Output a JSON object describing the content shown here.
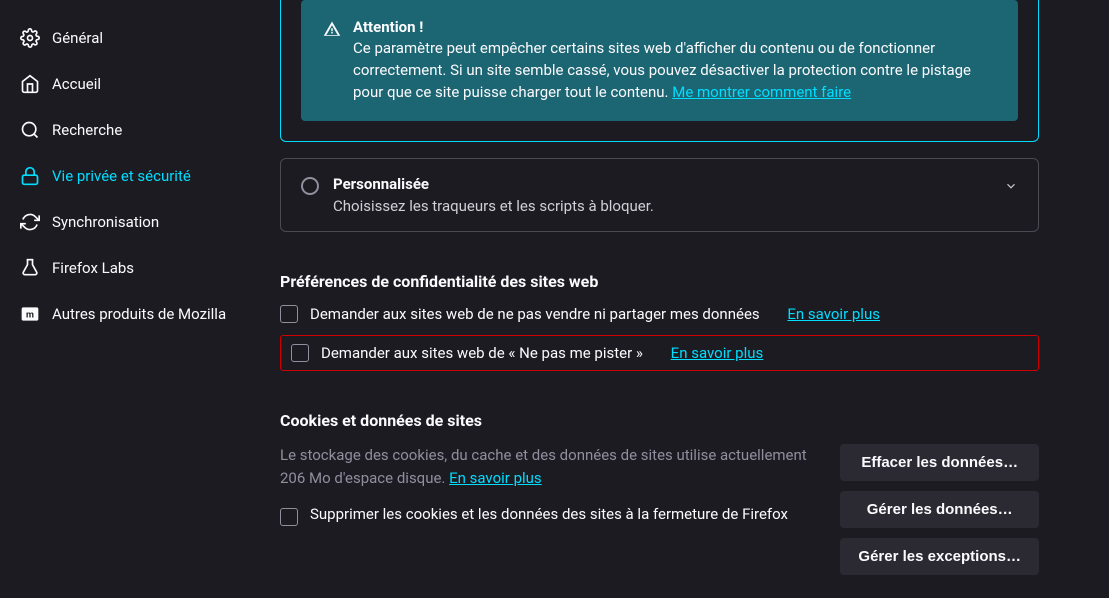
{
  "sidebar": {
    "items": [
      {
        "label": "Général"
      },
      {
        "label": "Accueil"
      },
      {
        "label": "Recherche"
      },
      {
        "label": "Vie privée et sécurité"
      },
      {
        "label": "Synchronisation"
      },
      {
        "label": "Firefox Labs"
      },
      {
        "label": "Autres produits de Mozilla"
      }
    ]
  },
  "warning": {
    "title": "Attention !",
    "text": "Ce paramètre peut empêcher certains sites web d'afficher du contenu ou de fonctionner correctement. Si un site semble cassé, vous pouvez désactiver la protection contre le pistage pour que ce site puisse charger tout le contenu. ",
    "link": "Me montrer comment faire"
  },
  "custom": {
    "title": "Personnalisée",
    "desc": "Choisissez les traqueurs et les scripts à bloquer."
  },
  "privacy": {
    "title": "Préférences de confidentialité des sites web",
    "opt1": "Demander aux sites web de ne pas vendre ni partager mes données",
    "opt1_link": "En savoir plus",
    "opt2": "Demander aux sites web de « Ne pas me pister »",
    "opt2_link": "En savoir plus"
  },
  "cookies": {
    "title": "Cookies et données de sites",
    "desc_prefix": "Le stockage des cookies, du cache et des données de sites utilise actuellement 206 Mo d'espace disque. ",
    "desc_link": "En savoir plus",
    "opt_delete": "Supprimer les cookies et les données des sites à la fermeture de Firefox",
    "btn_clear": "Effacer les données…",
    "btn_manage": "Gérer les données…",
    "btn_exceptions": "Gérer les exceptions…"
  }
}
